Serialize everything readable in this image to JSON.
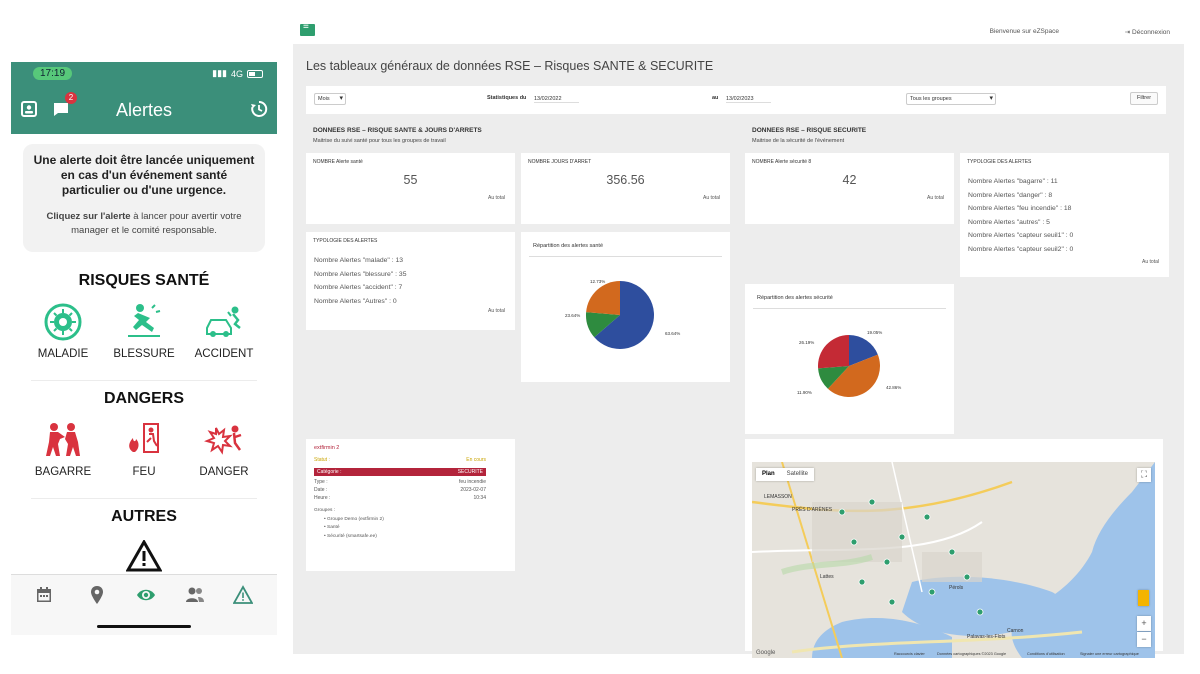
{
  "phone": {
    "status": {
      "time": "17:19",
      "network": "4G"
    },
    "header": {
      "title": "Alertes",
      "badge_count": "2"
    },
    "notice": {
      "main": "Une alerte doit être lancée uniquement en cas d'un événement santé particulier ou d'une urgence.",
      "sub_bold": "Cliquez sur l'alerte",
      "sub_rest": " à lancer pour avertir votre manager et le comité responsable."
    },
    "sections": {
      "health": {
        "title": "RISQUES SANTÉ",
        "items": [
          "MALADIE",
          "BLESSURE",
          "ACCIDENT"
        ]
      },
      "dangers": {
        "title": "DANGERS",
        "items": [
          "BAGARRE",
          "FEU",
          "DANGER"
        ]
      },
      "other": {
        "title": "AUTRES"
      }
    },
    "tabs": [
      "calendar-icon",
      "location-pin-icon",
      "eye-icon",
      "group-icon",
      "warning-icon"
    ],
    "colors": {
      "primary": "#3b8f7a",
      "health_icon": "#2cbf8a",
      "danger_icon": "#d9333f",
      "active_tab": "#2e9e6e"
    }
  },
  "dashboard": {
    "topbar": {
      "welcome": "Bienvenue sur eZSpace",
      "logout": "Déconnexion"
    },
    "title": "Les tableaux généraux de données RSE – Risques SANTE & SECURITE",
    "filter": {
      "period": "Mois",
      "stats_label": "Statistiques du",
      "date_from": "13/02/2022",
      "to_label": "au",
      "date_to": "13/02/2023",
      "group": "Tous les groupes",
      "button": "Filtrer"
    },
    "health": {
      "heading": "DONNEES RSE – RISQUE SANTE & JOURS D'ARRETS",
      "subheading": "Maitrise du suivi santé pour tous les groupes de travail",
      "kpi_alerts": {
        "label": "NOMBRE Alerte santé",
        "value": "55",
        "footer": "Au total"
      },
      "kpi_days": {
        "label": "NOMBRE JOURS D'ARRET",
        "value": "356.56",
        "footer": "Au total"
      },
      "types": {
        "label": "TYPOLOGIE DES ALERTES",
        "lines": [
          "Nombre Alertes \"malade\" : 13",
          "Nombre Alertes \"blessure\" : 35",
          "Nombre Alertes \"accident\" : 7",
          "Nombre Alertes \"Autres\" : 0"
        ],
        "footer": "Au total"
      },
      "chart": {
        "title": "Répartition des alertes santé"
      }
    },
    "security": {
      "heading": "DONNEES RSE – RISQUE SECURITE",
      "subheading": "Maitrise de la sécurité de l'événement",
      "kpi_alerts": {
        "label": "NOMBRE Alerte sécurité 8",
        "value": "42",
        "footer": "Au total"
      },
      "types": {
        "label": "TYPOLOGIE DES ALERTES",
        "lines": [
          "Nombre Alertes \"bagarre\" : 11",
          "Nombre Alertes \"danger\" : 8",
          "Nombre Alertes \"feu incendie\" : 18",
          "Nombre Alertes \"autres\" : 5",
          "Nombre Alertes \"capteur seuil1\" : 0",
          "Nombre Alertes \"capteur seuil2\" : 0"
        ],
        "footer": "Au total"
      },
      "chart": {
        "title": "Répartition des alertes sécurité"
      }
    },
    "task": {
      "title": "extfirmin 2",
      "status_label": "Statut :",
      "status_value": "En cours",
      "category_label": "Catégorie :",
      "category_value": "SECURITE",
      "rows": [
        {
          "k": "Type :",
          "v": "feu incendie"
        },
        {
          "k": "Date :",
          "v": "2023-02-07"
        },
        {
          "k": "Heure :",
          "v": "10:34"
        }
      ],
      "groups_label": "Groupes :",
      "groups": [
        "Groupe Demo (extfirmin 2)",
        "Santé",
        "Sécurité (smartsafe.ee)"
      ]
    },
    "map": {
      "tab_plan": "Plan",
      "tab_satellite": "Satellite",
      "logo": "Google",
      "footer": [
        "Raccourcis clavier",
        "Données cartographiques ©2023 Google",
        "Conditions d'utilisation",
        "Signaler une erreur cartographique"
      ],
      "places": [
        "LEMASSON",
        "PRÉS D'ARÈNES",
        "Lattes",
        "Pérols",
        "Palavas-les-Flots",
        "Carnon"
      ]
    }
  },
  "chart_data": [
    {
      "type": "pie",
      "title": "Répartition des alertes santé",
      "labels": [
        "blessure",
        "accident",
        "malade"
      ],
      "values": [
        63.64,
        12.73,
        23.64
      ],
      "value_labels": [
        "63.64%",
        "12.73%",
        "23.64%"
      ],
      "colors": [
        "#2e4e9e",
        "#2e8b3f",
        "#d2691e"
      ]
    },
    {
      "type": "pie",
      "title": "Répartition des alertes sécurité",
      "labels": [
        "danger",
        "feu incendie",
        "autres",
        "bagarre"
      ],
      "values": [
        19.05,
        42.86,
        11.9,
        26.19
      ],
      "value_labels": [
        "19.05%",
        "42.86%",
        "11.90%",
        "26.19%"
      ],
      "colors": [
        "#2e4e9e",
        "#d2691e",
        "#2e8b3f",
        "#c42a35"
      ]
    }
  ]
}
